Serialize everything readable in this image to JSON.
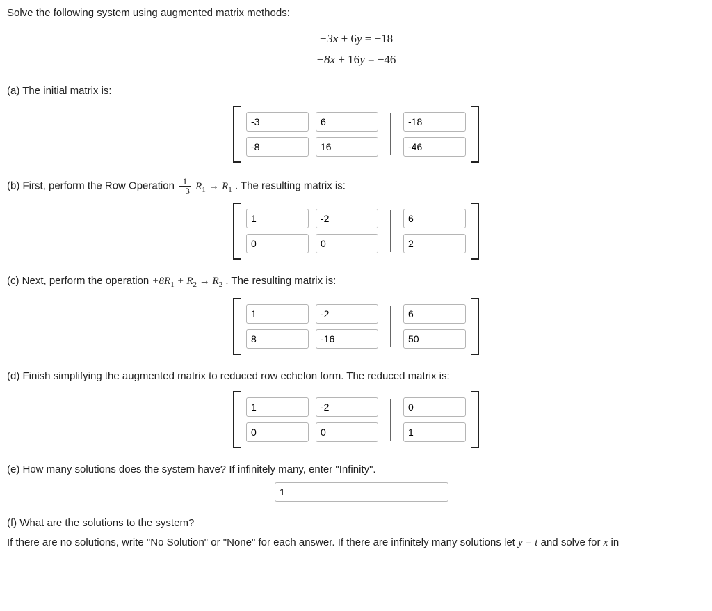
{
  "intro": "Solve the following system using augmented matrix methods:",
  "eq1": "−3x + 6y = −18",
  "eq2": "−8x + 16y = −46",
  "partA": {
    "label": "(a) The initial matrix is:",
    "m": [
      [
        "-3",
        "6",
        "-18"
      ],
      [
        "-8",
        "16",
        "-46"
      ]
    ]
  },
  "partB": {
    "prefix": "(b) First, perform the Row Operation ",
    "frac_num": "1",
    "frac_den": "−3",
    "op_tail_1": "R",
    "op_tail_1_sub": "1",
    "arrow": " → ",
    "op_tail_2": "R",
    "op_tail_2_sub": "1",
    "suffix": ". The resulting matrix is:",
    "m": [
      [
        "1",
        "-2",
        "6"
      ],
      [
        "0",
        "0",
        "2"
      ]
    ]
  },
  "partC": {
    "prefix": "(c) Next, perform the operation ",
    "op": "+8R₁ + R₂ → R₂",
    "suffix": ". The resulting matrix is:",
    "m": [
      [
        "1",
        "-2",
        "6"
      ],
      [
        "8",
        "-16",
        "50"
      ]
    ]
  },
  "partD": {
    "label": "(d) Finish simplifying the augmented matrix to reduced row echelon form. The reduced matrix is:",
    "m": [
      [
        "1",
        "-2",
        "0"
      ],
      [
        "0",
        "0",
        "1"
      ]
    ]
  },
  "partE": {
    "label": "(e) How many solutions does the system have? If infinitely many, enter \"Infinity\".",
    "value": "1"
  },
  "partF": {
    "label": "(f) What are the solutions to the system?",
    "hint": "If there are no solutions, write \"No Solution\" or \"None\" for each answer. If there are infinitely many solutions let y = t and solve for x in"
  }
}
